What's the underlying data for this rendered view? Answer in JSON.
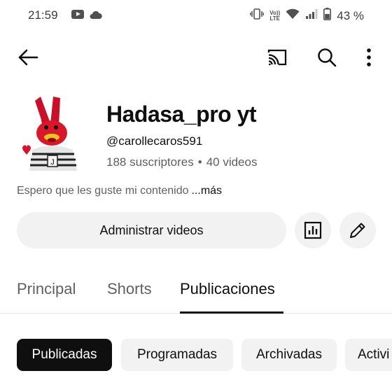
{
  "status_bar": {
    "time": "21:59",
    "battery_text": "43 %",
    "network_label_top": "Vo))",
    "network_label_bottom": "LTE"
  },
  "channel": {
    "name": "Hadasa_pro yt",
    "handle": "@carollecaros591",
    "subscribers": "188 suscriptores",
    "separator": "•",
    "videos": "40 videos",
    "description": "Espero que les guste mi contenido",
    "more_label": "...más"
  },
  "actions": {
    "manage_label": "Administrar videos"
  },
  "tabs": [
    {
      "label": "Principal"
    },
    {
      "label": "Shorts"
    },
    {
      "label": "Publicaciones"
    }
  ],
  "chips": [
    {
      "label": "Publicadas"
    },
    {
      "label": "Programadas"
    },
    {
      "label": "Archivadas"
    },
    {
      "label": "Activi"
    }
  ],
  "icons": {
    "back": "arrow-left-icon",
    "cast": "cast-icon",
    "search": "search-icon",
    "more": "more-vert-icon",
    "analytics": "analytics-icon",
    "edit": "pencil-icon"
  },
  "colors": {
    "text_primary": "#0f0f0f",
    "text_secondary": "#606060",
    "chip_bg": "#f2f2f2",
    "chip_selected_bg": "#0f0f0f"
  }
}
